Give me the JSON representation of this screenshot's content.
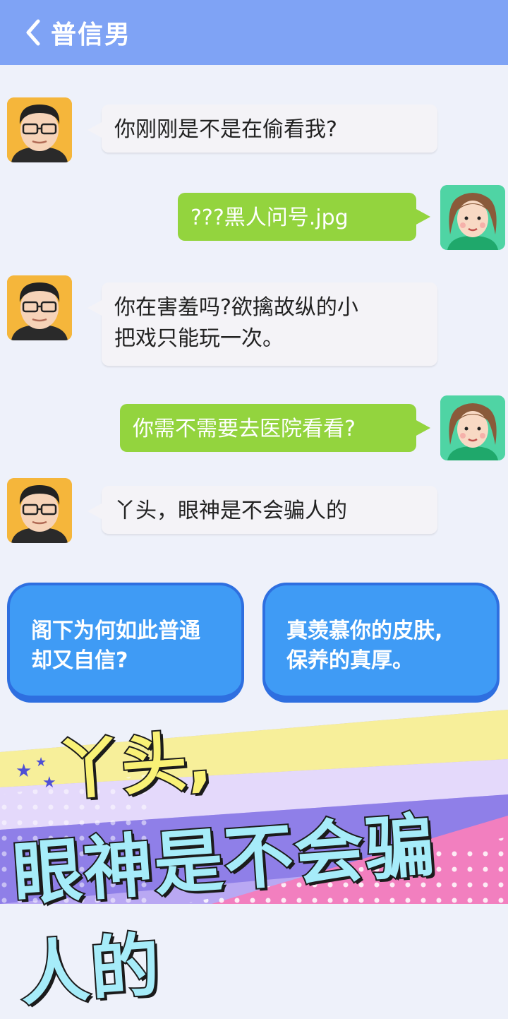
{
  "header": {
    "title": "普信男",
    "back_icon": "chevron-left-icon"
  },
  "messages": [
    {
      "side": "left",
      "text": "你刚刚是不是在偷看我?"
    },
    {
      "side": "right",
      "text": "???黑人问号.jpg"
    },
    {
      "side": "left",
      "line1": "你在害羞吗?欲擒故纵的小",
      "line2": "把戏只能玩一次。"
    },
    {
      "side": "right",
      "text": "你需不需要去医院看看?"
    },
    {
      "side": "left",
      "text": "丫头，眼神是不会骗人的"
    }
  ],
  "options": [
    {
      "line1": "阁下为何如此普通",
      "line2": "却又自信?"
    },
    {
      "line1": "真羡慕你的皮肤,",
      "line2": "保养的真厚。"
    }
  ],
  "banner": {
    "line1": "丫头,",
    "line2": "眼神是不会骗人的"
  },
  "colors": {
    "header": "#7fa3f5",
    "incoming_bubble": "#f4f3f7",
    "outgoing_bubble": "#93d43e",
    "option": "#3f9bf5"
  }
}
